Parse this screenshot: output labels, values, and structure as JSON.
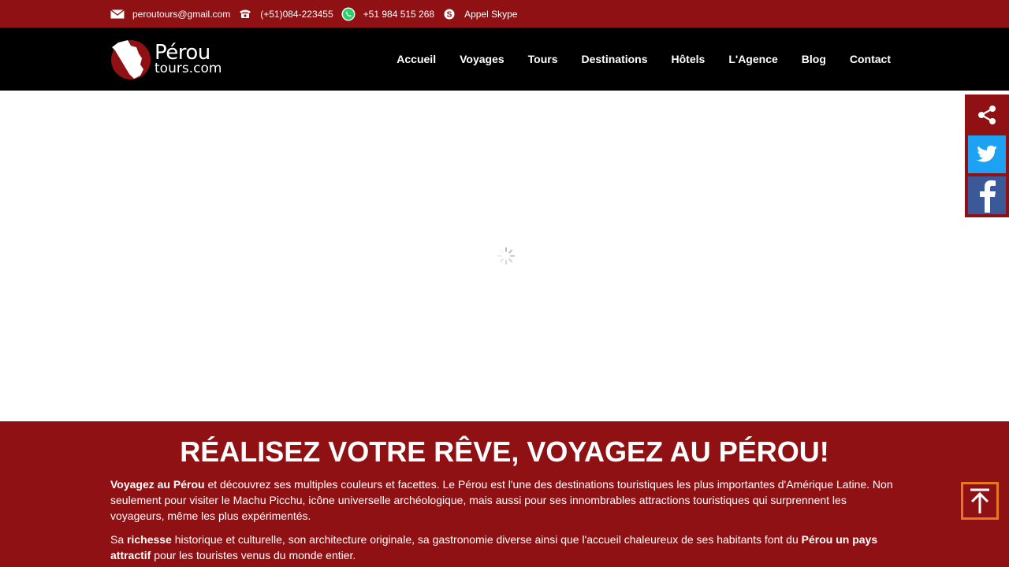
{
  "topbar": {
    "email": "peroutours@gmail.com",
    "phone": "(+51)084-223455",
    "whatsapp": "+51 984 515 268",
    "skype": "Appel Skype"
  },
  "logo": {
    "line1": "Pérou",
    "line2": "tours.com"
  },
  "nav": {
    "items": [
      "Accueil",
      "Voyages",
      "Tours",
      "Destinations",
      "Hôtels",
      "L'Agence",
      "Blog",
      "Contact"
    ]
  },
  "section": {
    "title": "RÉALISEZ VOTRE RÊVE, VOYAGEZ AU PÉROU!",
    "p1_bold": "Voyagez au Pérou",
    "p1_rest": " et découvrez ses multiples couleurs et facettes. Le Pérou est l'une des destinations touristiques les plus importantes d'Amérique Latine. Non seulement pour visiter le Machu Picchu, icône universelle archéologique, mais aussi pour ses innombrables attractions touristiques qui surprennent les voyageurs, même les plus expérimentés.",
    "p2_a": "Sa ",
    "p2_bold1": "richesse",
    "p2_b": " historique et culturelle, son architecture originale, sa gastronomie diverse ainsi que l'accueil chaleureux de ses habitants font du ",
    "p2_bold2": "Pérou un pays attractif",
    "p2_c": " pour les touristes venus du monde entier."
  },
  "colors": {
    "brand": "#8f1113",
    "nav_bg": "#000000",
    "twitter": "#1da1f2",
    "facebook": "#3b5998",
    "totop_border": "#e87722"
  },
  "icons": [
    "mail-icon",
    "phone-icon",
    "whatsapp-icon",
    "skype-icon",
    "share-icon",
    "twitter-icon",
    "facebook-icon",
    "arrow-up-icon",
    "loading-spinner-icon"
  ]
}
